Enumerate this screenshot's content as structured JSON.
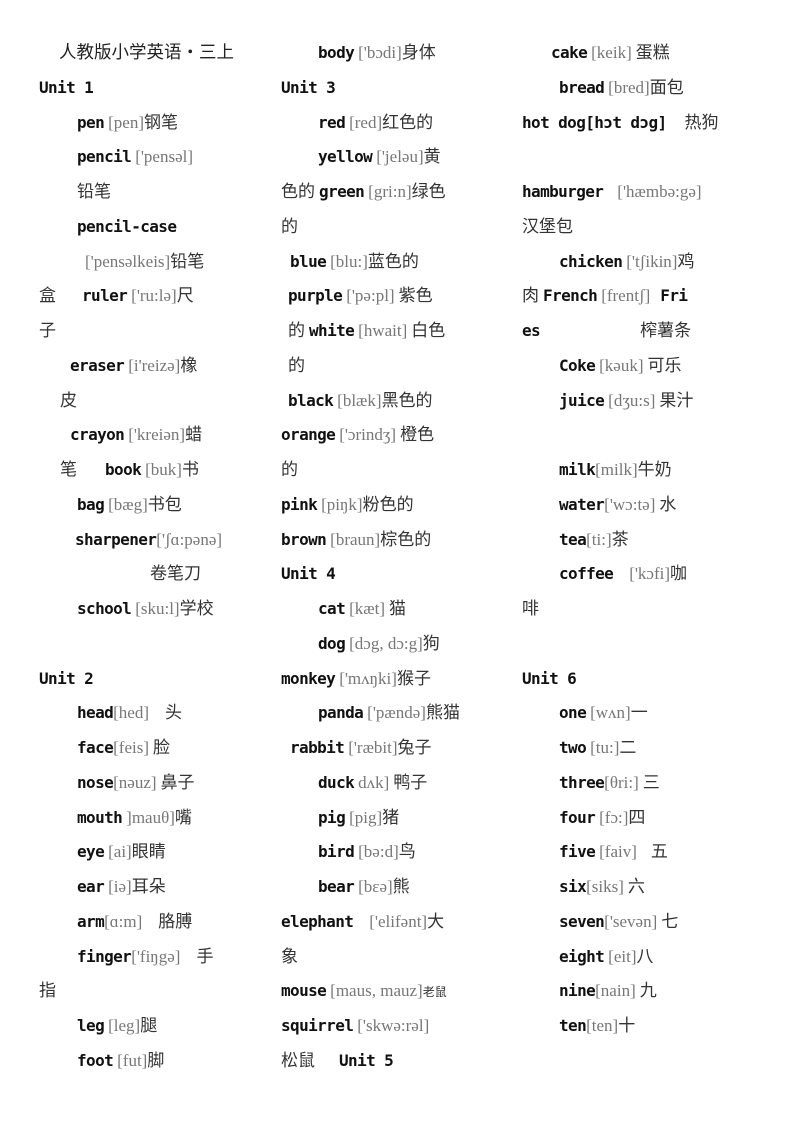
{
  "title": "人教版小学英语・三上",
  "units": {
    "u1": "Unit 1",
    "u2": "Unit 2",
    "u3": "Unit 3",
    "u4": "Unit 4",
    "u5": "Unit 5",
    "u6": "Unit 6"
  },
  "words": {
    "pen": {
      "word": "pen",
      "phon": "[pen]",
      "cn": "钢笔"
    },
    "pencil": {
      "word": "pencil",
      "phon": "['pensəl]",
      "cn": "铅笔"
    },
    "pencil_case": {
      "word": "pencil-case",
      "phon": "['pensəlkeis]",
      "cn": "铅笔",
      "cn2": "盒"
    },
    "ruler": {
      "word": "ruler",
      "phon": "['ru:lə]",
      "cn": "尺",
      "cn2": "子"
    },
    "eraser": {
      "word": "eraser",
      "phon": "[i'reizə]",
      "cn": "橡",
      "cn2": "皮"
    },
    "crayon": {
      "word": "crayon",
      "phon": "['kreiən]",
      "cn": "蜡",
      "cn2": "笔"
    },
    "book": {
      "word": "book",
      "phon": "[buk]",
      "cn": "书"
    },
    "bag": {
      "word": "bag",
      "phon": "[bæg]",
      "cn": "书包"
    },
    "sharpener": {
      "word": "sharpener",
      "phon": "['ʃɑ:pənə]",
      "cn": "卷笔刀"
    },
    "school": {
      "word": "school",
      "phon": "[sku:l]",
      "cn": "学校"
    },
    "head": {
      "word": "head",
      "phon": "[hed]",
      "cn": "头"
    },
    "face": {
      "word": "face",
      "phon": "[feis]",
      "cn": "脸"
    },
    "nose": {
      "word": "nose",
      "phon": "[nəuz]",
      "cn": "鼻子"
    },
    "mouth": {
      "word": "mouth",
      "phon": "]mauθ]",
      "cn": "嘴"
    },
    "eye": {
      "word": "eye",
      "phon": "[ai]",
      "cn": "眼睛"
    },
    "ear": {
      "word": "ear",
      "phon": "[iə]",
      "cn": "耳朵"
    },
    "arm": {
      "word": "arm",
      "phon": "[ɑ:m]",
      "cn": "胳膊"
    },
    "finger": {
      "word": "finger",
      "phon": "['fiŋgə]",
      "cn": "手",
      "cn2": "指"
    },
    "leg": {
      "word": "leg",
      "phon": "[leg]",
      "cn": "腿"
    },
    "foot": {
      "word": "foot",
      "phon": "[fut]",
      "cn": "脚"
    },
    "body": {
      "word": "body",
      "phon": "['bɔdi]",
      "cn": "身体"
    },
    "red": {
      "word": "red",
      "phon": "[red]",
      "cn": "红色的"
    },
    "yellow": {
      "word": "yellow",
      "phon": "['jeləu]",
      "cn": "黄",
      "cn2": "色的"
    },
    "green": {
      "word": "green",
      "phon": "[gri:n]",
      "cn": "绿色",
      "cn2": "的"
    },
    "blue": {
      "word": "blue",
      "phon": "[blu:]",
      "cn": "蓝色的"
    },
    "purple": {
      "word": "purple",
      "phon": "['pə:pl]",
      "cn": "紫色",
      "cn2": "的"
    },
    "white": {
      "word": "white",
      "phon": "[hwait]",
      "cn": "白色",
      "cn2": "的"
    },
    "black": {
      "word": "black",
      "phon": "[blæk]",
      "cn": "黑色的"
    },
    "orange": {
      "word": "orange",
      "phon": "['ɔrindʒ]",
      "cn": "橙色",
      "cn2": "的"
    },
    "pink": {
      "word": "pink",
      "phon": "[piŋk]",
      "cn": "粉色的"
    },
    "brown": {
      "word": "brown",
      "phon": "[braun]",
      "cn": "棕色的"
    },
    "cat": {
      "word": "cat",
      "phon": "[kæt]",
      "cn": "猫"
    },
    "dog": {
      "word": "dog",
      "phon": "[dɔg, dɔ:g]",
      "cn": "狗"
    },
    "monkey": {
      "word": "monkey",
      "phon": "['mʌŋki]",
      "cn": "猴子"
    },
    "panda": {
      "word": "panda",
      "phon": "['pændə]",
      "cn": "熊猫"
    },
    "rabbit": {
      "word": "rabbit",
      "phon": "['ræbit]",
      "cn": "兔子"
    },
    "duck": {
      "word": "duck",
      "phon": "dʌk]",
      "cn": "鸭子"
    },
    "pig": {
      "word": "pig",
      "phon": "[pig]",
      "cn": "猪"
    },
    "bird": {
      "word": "bird",
      "phon": "[bə:d]",
      "cn": "鸟"
    },
    "bear": {
      "word": "bear",
      "phon": "[bεə]",
      "cn": "熊"
    },
    "elephant": {
      "word": "elephant",
      "phon": "['elifənt]",
      "cn": "大",
      "cn2": "象"
    },
    "mouse": {
      "word": "mouse",
      "phon": "[maus, mauz]",
      "cn": "老鼠"
    },
    "squirrel": {
      "word": "squirrel",
      "phon": "['skwə:rəl]",
      "cn": "松鼠"
    },
    "cake": {
      "word": "cake",
      "phon": "[keik]",
      "cn": "蛋糕"
    },
    "bread": {
      "word": "bread",
      "phon": "[bred]",
      "cn": "面包"
    },
    "hot_dog": {
      "word": "hot dog[hɔt dɔg]",
      "cn": "热狗"
    },
    "hamburger": {
      "word": "hamburger",
      "phon": "['hæmbə:gə]",
      "cn": "汉堡包"
    },
    "chicken": {
      "word": "chicken",
      "phon": "['tʃikin]",
      "cn": "鸡",
      "cn2": "肉"
    },
    "french_fries": {
      "word": "French",
      "phon": "[frentʃ]",
      "word2": "Fri",
      "word3": "es",
      "cn": "榨薯条"
    },
    "coke": {
      "word": "Coke",
      "phon": "[kəuk]",
      "cn": "可乐"
    },
    "juice": {
      "word": "juice",
      "phon": "[dʒu:s]",
      "cn": "果汁"
    },
    "milk": {
      "word": "milk",
      "phon": "[milk]",
      "cn": "牛奶"
    },
    "water": {
      "word": "water",
      "phon": "['wɔ:tə]",
      "cn": "水"
    },
    "tea": {
      "word": "tea",
      "phon": "[ti:]",
      "cn": "茶"
    },
    "coffee": {
      "word": "coffee",
      "phon": "['kɔfi]",
      "cn": "咖",
      "cn2": "啡"
    },
    "one": {
      "word": "one",
      "phon": "[wʌn]",
      "cn": "一"
    },
    "two": {
      "word": "two",
      "phon": "[tu:]",
      "cn": "二"
    },
    "three": {
      "word": "three",
      "phon": "[θri:]",
      "cn": "三"
    },
    "four": {
      "word": "four",
      "phon": "[fɔ:]",
      "cn": "四"
    },
    "five": {
      "word": "five",
      "phon": "[faiv]",
      "cn": "五"
    },
    "six": {
      "word": "six",
      "phon": "[siks]",
      "cn": "六"
    },
    "seven": {
      "word": "seven",
      "phon": "['sevən]",
      "cn": "七"
    },
    "eight": {
      "word": "eight",
      "phon": "[eit]",
      "cn": "八"
    },
    "nine": {
      "word": "nine",
      "phon": "[nain]",
      "cn": "九"
    },
    "ten": {
      "word": "ten",
      "phon": "[ten]",
      "cn": "十"
    }
  }
}
